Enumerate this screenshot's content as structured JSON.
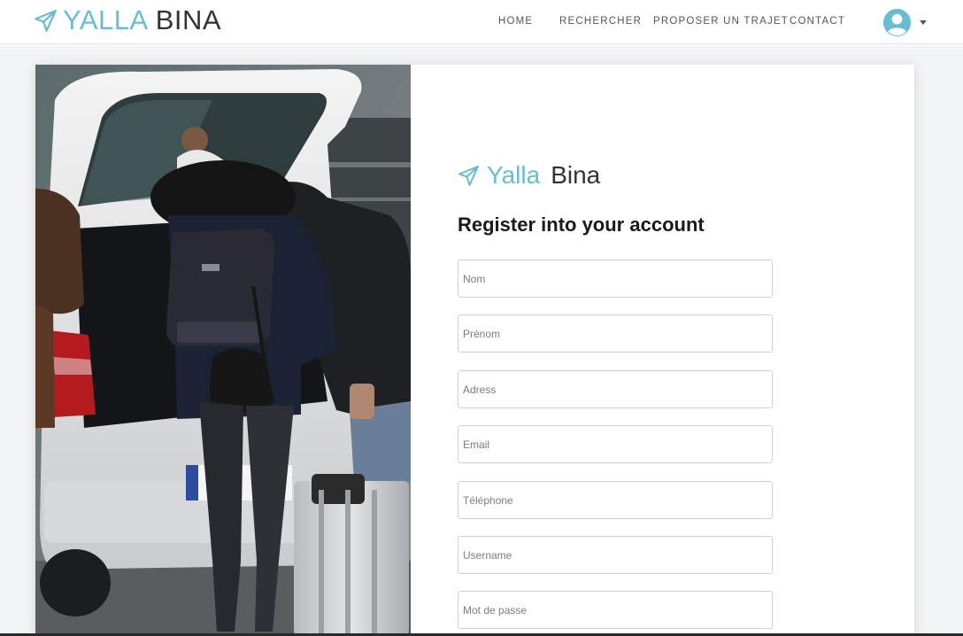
{
  "navbar": {
    "brand_part1": "YALLA",
    "brand_part2": "BINA",
    "links": [
      "HOME",
      "RECHERCHER",
      "PROPOSER UN TRAJET",
      "CONTACT"
    ]
  },
  "form": {
    "brand_part1": "Yalla",
    "brand_part2": "Bina",
    "title": "Register into your account",
    "fields": [
      {
        "placeholder": "Nom",
        "value": ""
      },
      {
        "placeholder": "Prénom",
        "value": ""
      },
      {
        "placeholder": "Adress",
        "value": ""
      },
      {
        "placeholder": "Email",
        "value": ""
      },
      {
        "placeholder": "Téléphone",
        "value": ""
      },
      {
        "placeholder": "Username",
        "value": ""
      },
      {
        "placeholder": "Mot de passe",
        "value": ""
      }
    ]
  },
  "colors": {
    "accent": "#69bdd2",
    "text": "#333333",
    "page_bg": "#f3f4f5"
  },
  "icons": {
    "brand": "paper-plane-icon",
    "user": "user-circle-icon",
    "dropdown": "caret-down-icon"
  }
}
